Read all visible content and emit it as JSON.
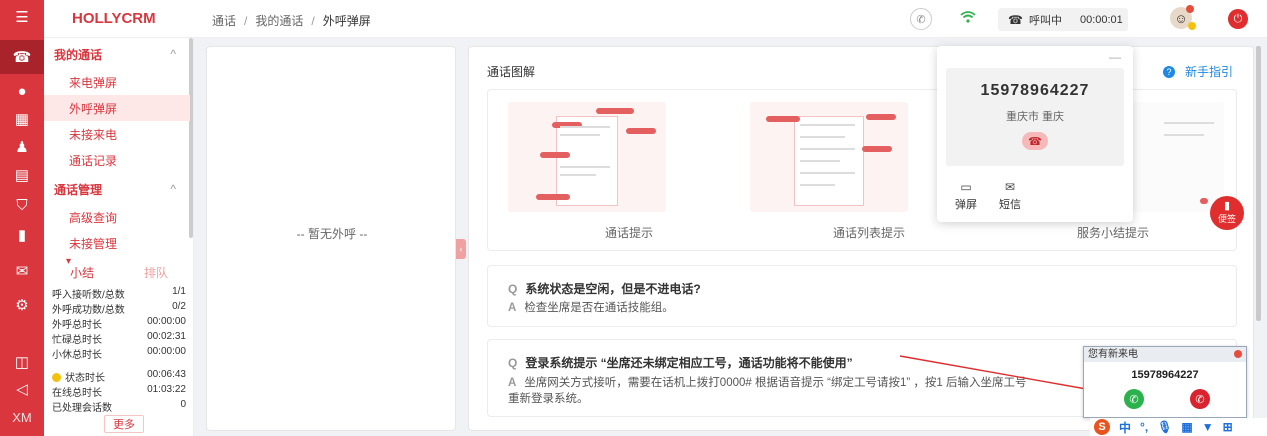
{
  "app": {
    "brand": "HOLLYCRM",
    "rail_footer": "XM"
  },
  "breadcrumb": {
    "level1": "通话",
    "level2": "我的通话",
    "current": "外呼弹屏",
    "separator": "/"
  },
  "header": {
    "call_status": "呼叫中",
    "call_timer": "00:00:01"
  },
  "sidebar": {
    "group1": {
      "label": "我的通话",
      "chevron": "^"
    },
    "group1_items": [
      "来电弹屏",
      "外呼弹屏",
      "未接来电",
      "通话记录"
    ],
    "group2": {
      "label": "通话管理",
      "chevron": "^"
    },
    "group2_items": [
      "高级查询",
      "未接管理"
    ],
    "tabs": {
      "active": "小结",
      "inactive": "排队"
    },
    "stats": [
      {
        "label": "呼入接听数/总数",
        "value": "1/1"
      },
      {
        "label": "外呼成功数/总数",
        "value": "0/2"
      },
      {
        "label": "外呼总时长",
        "value": "00:00:00"
      },
      {
        "label": "忙碌总时长",
        "value": "00:02:31"
      },
      {
        "label": "小休总时长",
        "value": "00:00:00"
      },
      {
        "label": "状态时长",
        "value": "00:06:43"
      },
      {
        "label": "在线总时长",
        "value": "01:03:22"
      },
      {
        "label": "已处理会话数",
        "value": "0"
      }
    ],
    "more_label": "更多"
  },
  "left_panel": {
    "empty_text": "-- 暂无外呼 --"
  },
  "main": {
    "section_title": "通话图解",
    "guide_link": "新手指引",
    "thumbnails": [
      "通话提示",
      "通话列表提示",
      "服务小结提示"
    ],
    "faqs": [
      {
        "q_mark": "Q",
        "question": "系统状态是空闲，但是不进电话?",
        "a_mark": "A",
        "answer": "检查坐席是否在通话技能组。"
      },
      {
        "q_mark": "Q",
        "question": "登录系统提示 “坐席还未绑定相应工号，通话功能将不能使用”",
        "a_mark": "A",
        "answer": "坐席网关方式接听，需要在话机上拨打0000# 根据语音提示 “绑定工号请按1” ，按1 后输入坐席工号",
        "answer2": "重新登录系统。"
      }
    ]
  },
  "call_popover": {
    "dash": "—",
    "number": "15978964227",
    "location": "重庆市 重庆",
    "actions": [
      {
        "icon": "screen-icon",
        "label": "弹屏"
      },
      {
        "icon": "sms-icon",
        "label": "短信"
      }
    ]
  },
  "sticky_note": {
    "label": "便签"
  },
  "incoming_call": {
    "title": "您有新来电",
    "number": "15978964227"
  },
  "ime": {
    "lang": "中",
    "punct": "°,"
  },
  "colors": {
    "brand_red": "#d9363e",
    "accept_green": "#2bb24c",
    "reject_red": "#d9232e",
    "link_blue": "#1e88e5"
  }
}
